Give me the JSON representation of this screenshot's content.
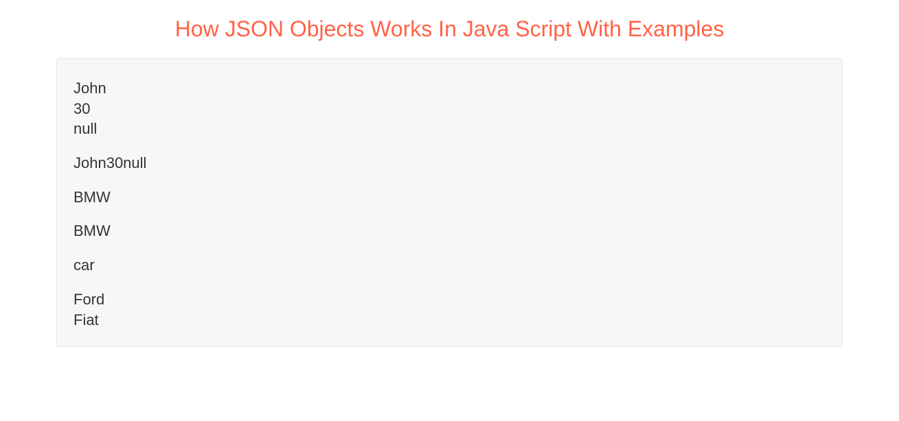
{
  "header": {
    "title": "How JSON Objects Works In Java Script With Examples"
  },
  "output": {
    "block1": {
      "line1": "John",
      "line2": "30",
      "line3": "null"
    },
    "block2": {
      "line1": "John30null"
    },
    "block3": {
      "line1": "BMW"
    },
    "block4": {
      "line1": "BMW"
    },
    "block5": {
      "line1": "car"
    },
    "block6": {
      "line1": "Ford",
      "line2": "Fiat"
    }
  }
}
